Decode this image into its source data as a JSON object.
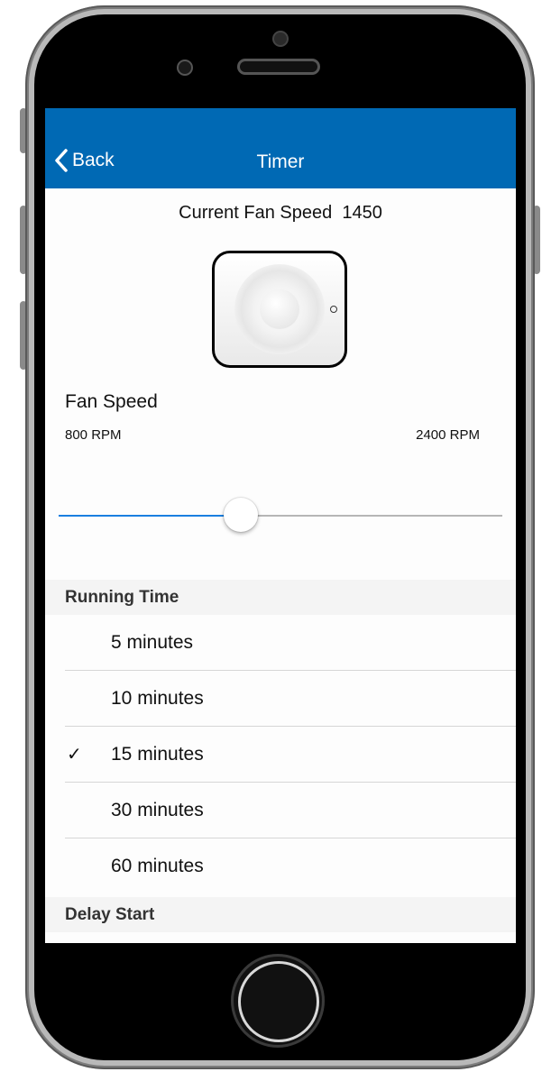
{
  "nav": {
    "back_label": "Back",
    "title": "Timer"
  },
  "status": {
    "current_speed_label": "Current Fan Speed",
    "current_speed_value": "1450"
  },
  "fan_speed": {
    "label": "Fan Speed",
    "min_label": "800 RPM",
    "max_label": "2400 RPM",
    "slider_fraction": 0.41,
    "accent_color": "#1a7fe0"
  },
  "running_time": {
    "header": "Running Time",
    "options": [
      {
        "label": "5  minutes",
        "checked": false
      },
      {
        "label": "10  minutes",
        "checked": false
      },
      {
        "label": "15  minutes",
        "checked": true
      },
      {
        "label": "30  minutes",
        "checked": false
      },
      {
        "label": "60  minutes",
        "checked": false
      }
    ],
    "check_glyph": "✓"
  },
  "delay_start": {
    "header": "Delay Start"
  },
  "colors": {
    "navbar": "#0069b4"
  }
}
